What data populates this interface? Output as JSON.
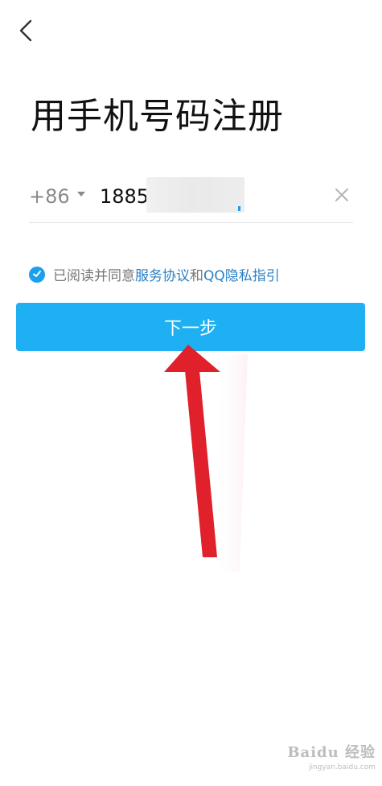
{
  "header": {
    "back_icon": "chevron-left-icon"
  },
  "page": {
    "title": "用手机号码注册"
  },
  "phone": {
    "country_code": "+86",
    "caret_icon": "caret-down-icon",
    "value": "1885",
    "clear_icon": "close-icon"
  },
  "agreement": {
    "checked": true,
    "check_icon": "checkmark-icon",
    "text": "已阅读并同意",
    "link1": "服务协议",
    "connector": "和",
    "link2": "QQ隐私指引"
  },
  "actions": {
    "next_label": "下一步"
  },
  "annotation": {
    "arrow_color": "#e0202a"
  },
  "watermark": {
    "logo": "Baidu 经验",
    "url": "jingyan.baidu.com"
  },
  "colors": {
    "accent": "#1eb0f2",
    "link": "#2b7fc7"
  }
}
